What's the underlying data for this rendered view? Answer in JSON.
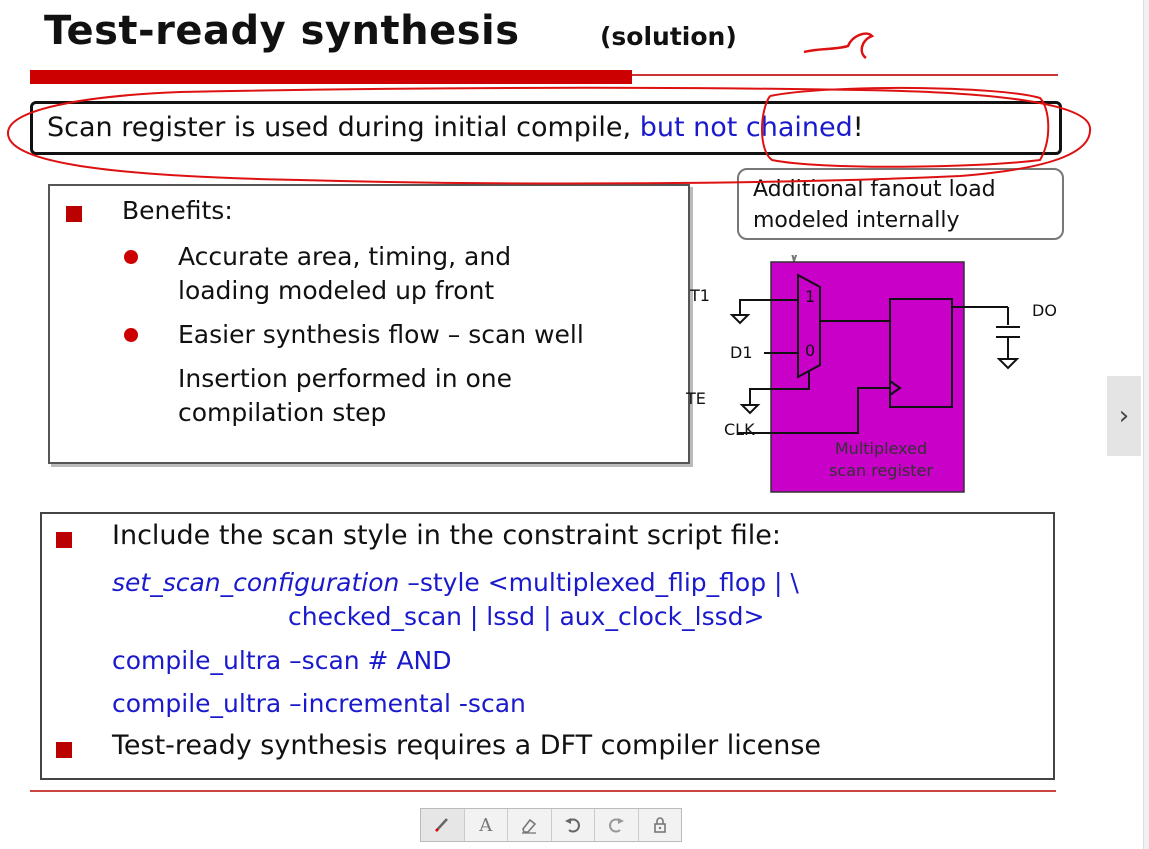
{
  "slide": {
    "title": "Test-ready synthesis",
    "subtitle": "(solution)",
    "banner_main": "Scan register is used during initial compile, ",
    "banner_highlight": "but not chained",
    "banner_end": "!",
    "benefits": {
      "heading": "Benefits:",
      "bullet1_line1": "Accurate area, timing, and",
      "bullet1_line2": "loading modeled up front",
      "bullet2_line1": "Easier synthesis flow – scan well",
      "bullet2_line2": "Insertion performed in one",
      "bullet2_line3": "compilation step"
    },
    "callout_line1": "Additional fanout load",
    "callout_line2": "modeled internally",
    "diagram": {
      "t1": "T1",
      "d1": "D1",
      "te": "TE",
      "clk": "CLK",
      "do": "DO",
      "mux_in1": "1",
      "mux_in0": "0",
      "register_line1": "Multiplexed",
      "register_line2": "scan register",
      "register_color": "#c800c8"
    },
    "script": {
      "heading": "Include the scan style in the constraint script file:",
      "cmd1_cmd": "set_scan_configuration",
      "cmd1_rest": " –style <multiplexed_flip_flop  |  \\",
      "cmd1_cont": "checked_scan | lssd | aux_clock_lssd>",
      "cmd2": "compile_ultra  –scan # AND",
      "cmd3": "compile_ultra  –incremental  -scan",
      "note": "Test-ready synthesis requires a DFT compiler license"
    }
  },
  "toolbar": {
    "pen": "pen-icon",
    "text": "A",
    "eraser": "eraser-icon",
    "undo": "undo-icon",
    "redo": "redo-icon",
    "lock": "lock-icon"
  },
  "nav": {
    "next_icon": "›"
  },
  "colors": {
    "accent_red": "#cc0000",
    "command_blue": "#1a1acc",
    "annotation_red": "#dd1111"
  }
}
